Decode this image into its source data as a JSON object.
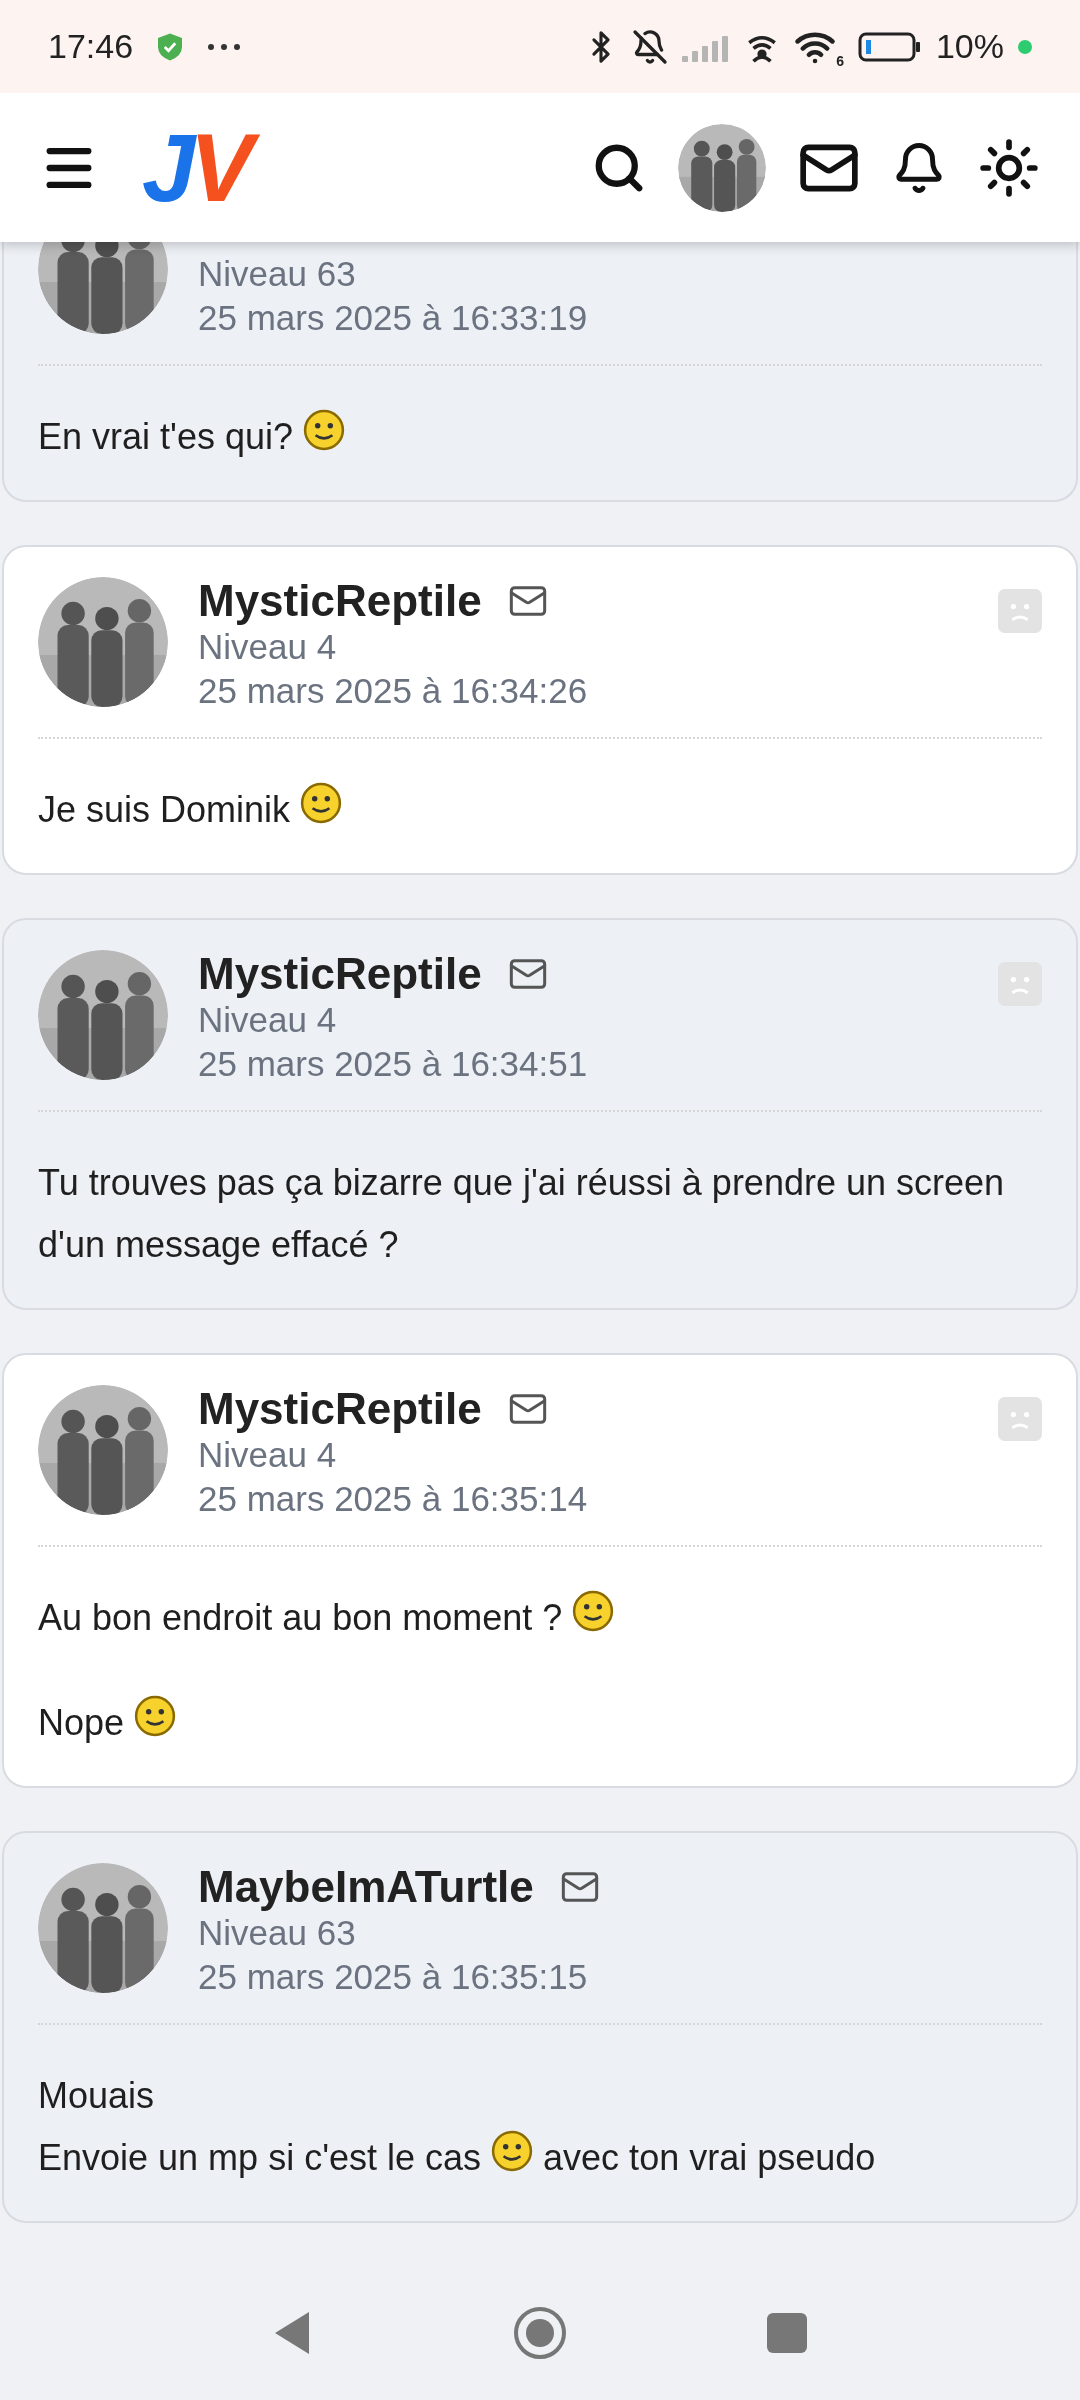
{
  "status_bar": {
    "time": "17:46",
    "wifi_badge": "6",
    "battery": "10%"
  },
  "header": {
    "logo": "JV"
  },
  "posts": [
    {
      "level": "Niveau 63",
      "date": "25 mars 2025 à 16:33:19",
      "report": false,
      "paragraphs": [
        [
          [
            {
              "kind": "text",
              "text": "En vrai t'es qui?"
            },
            {
              "kind": "smiley"
            }
          ]
        ]
      ]
    },
    {
      "author": "MysticReptile",
      "level": "Niveau 4",
      "date": "25 mars 2025 à 16:34:26",
      "report": true,
      "paragraphs": [
        [
          [
            {
              "kind": "text",
              "text": "Je suis Dominik"
            },
            {
              "kind": "smiley"
            }
          ]
        ]
      ]
    },
    {
      "author": "MysticReptile",
      "level": "Niveau 4",
      "date": "25 mars 2025 à 16:34:51",
      "report": true,
      "paragraphs": [
        [
          [
            {
              "kind": "text",
              "text": "Tu trouves pas ça bizarre que j'ai réussi à prendre un screen d'un message effacé ?"
            }
          ]
        ]
      ]
    },
    {
      "author": "MysticReptile",
      "level": "Niveau 4",
      "date": "25 mars 2025 à 16:35:14",
      "report": true,
      "paragraphs": [
        [
          [
            {
              "kind": "text",
              "text": "Au bon endroit au bon moment ?"
            },
            {
              "kind": "smiley"
            }
          ]
        ],
        [
          [
            {
              "kind": "text",
              "text": "Nope"
            },
            {
              "kind": "smiley"
            }
          ]
        ]
      ]
    },
    {
      "author": "MaybeImATurtle",
      "level": "Niveau 63",
      "date": "25 mars 2025 à 16:35:15",
      "report": false,
      "paragraphs": [
        [
          [
            {
              "kind": "text",
              "text": "Mouais"
            }
          ],
          [
            {
              "kind": "text",
              "text": "Envoie un mp si c'est le cas"
            },
            {
              "kind": "smiley"
            },
            {
              "kind": "text",
              "text": "avec ton vrai pseudo"
            }
          ]
        ]
      ]
    }
  ]
}
